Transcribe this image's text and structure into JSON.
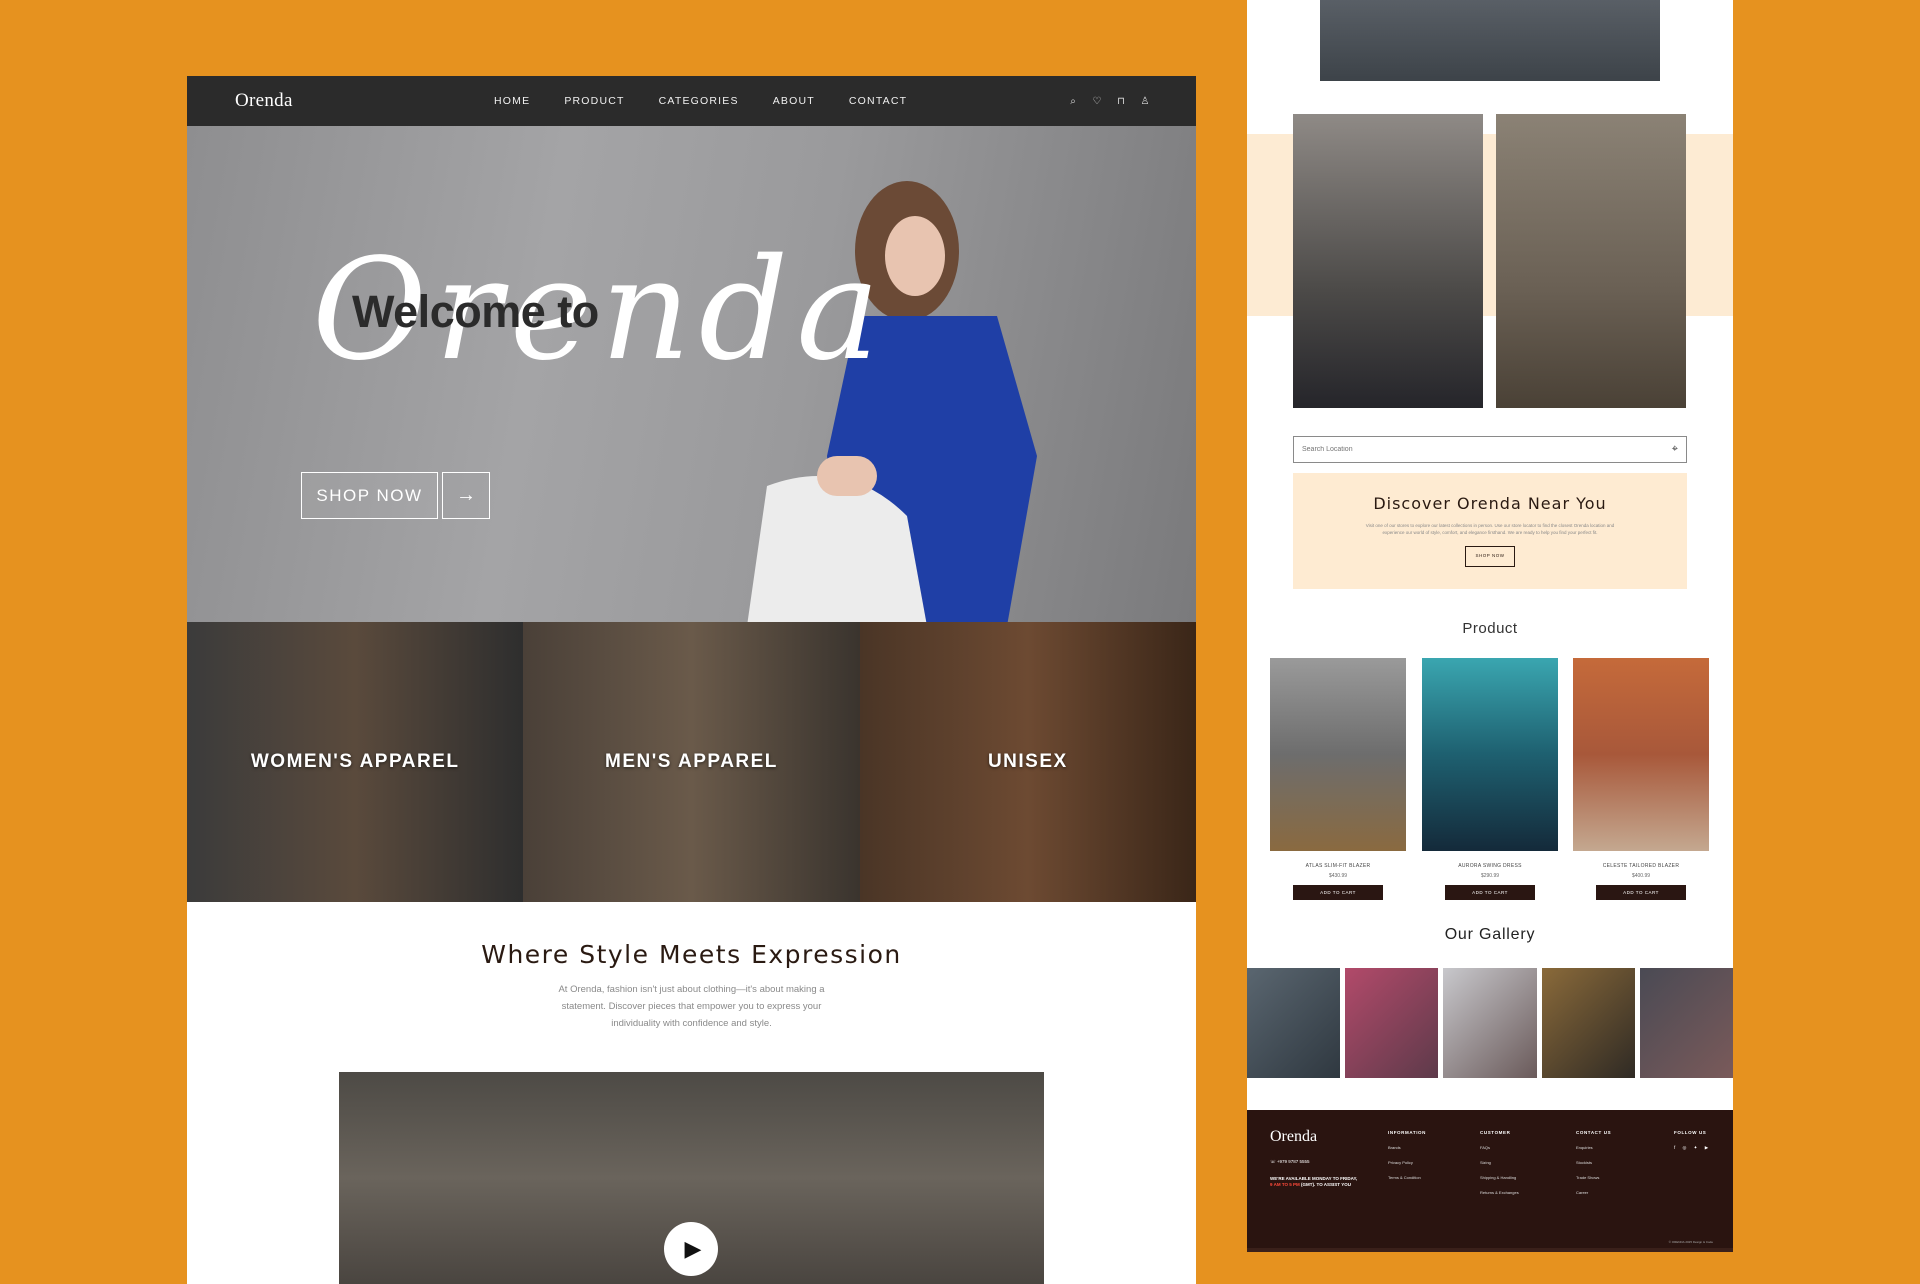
{
  "left": {
    "nav": {
      "logo": "Orenda",
      "links": [
        "HOME",
        "PRODUCT",
        "CATEGORIES",
        "ABOUT",
        "CONTACT"
      ],
      "icons": [
        "search-icon",
        "heart-icon",
        "bag-icon",
        "user-icon"
      ]
    },
    "hero": {
      "welcome": "Welcome to",
      "brand_script": "Orenda",
      "shop_now": "SHOP NOW"
    },
    "categories": [
      "WOMEN'S APPAREL",
      "MEN'S APPAREL",
      "UNISEX"
    ],
    "about": {
      "title": "Where Style Meets Expression",
      "body": "At Orenda, fashion isn't just about clothing—it's about making a statement. Discover pieces that empower you to express your individuality with confidence and style."
    }
  },
  "right": {
    "search": {
      "placeholder": "Search Location"
    },
    "near": {
      "title": "Discover Orenda Near You",
      "body": "Visit one of our stores to explore our latest collections in person. Use our store locator to find the closest Orenda location and experience our world of style, comfort, and elegance firsthand. We are ready to help you find your perfect fit.",
      "button": "SHOP NOW"
    },
    "product_title": "Product",
    "products": [
      {
        "name": "ATLAS SLIM-FIT BLAZER",
        "price": "$430.99",
        "cart": "ADD TO CART"
      },
      {
        "name": "AURORA SWING DRESS",
        "price": "$290.99",
        "cart": "ADD TO CART"
      },
      {
        "name": "CELESTE TAILORED BLAZER",
        "price": "$400.99",
        "cart": "ADD TO CART"
      }
    ],
    "gallery_title": "Our Gallery",
    "footer": {
      "logo": "Orenda",
      "phone": "+979 9787 5555",
      "availability_prefix": "WE'RE AVAILABLE MONDAY TO FRIDAY,",
      "availability_hours": "9 AM TO 5 PM",
      "availability_suffix": "(GMT). TO ASSIST YOU",
      "columns": [
        {
          "heading": "INFORMATION",
          "items": [
            "Brands",
            "Privacy Policy",
            "Terms & Condition"
          ]
        },
        {
          "heading": "CUSTOMER",
          "items": [
            "FAQs",
            "Sizing",
            "Shipping & Handling",
            "Returns & Exchanges"
          ]
        },
        {
          "heading": "CONTACT US",
          "items": [
            "Enquiries",
            "Stockists",
            "Trade Shows",
            "Career"
          ]
        }
      ],
      "follow_heading": "FOLLOW US",
      "social": "f ◎ ✦ ▶",
      "copyright": "© ORENDA 2025 Design & Code"
    }
  }
}
